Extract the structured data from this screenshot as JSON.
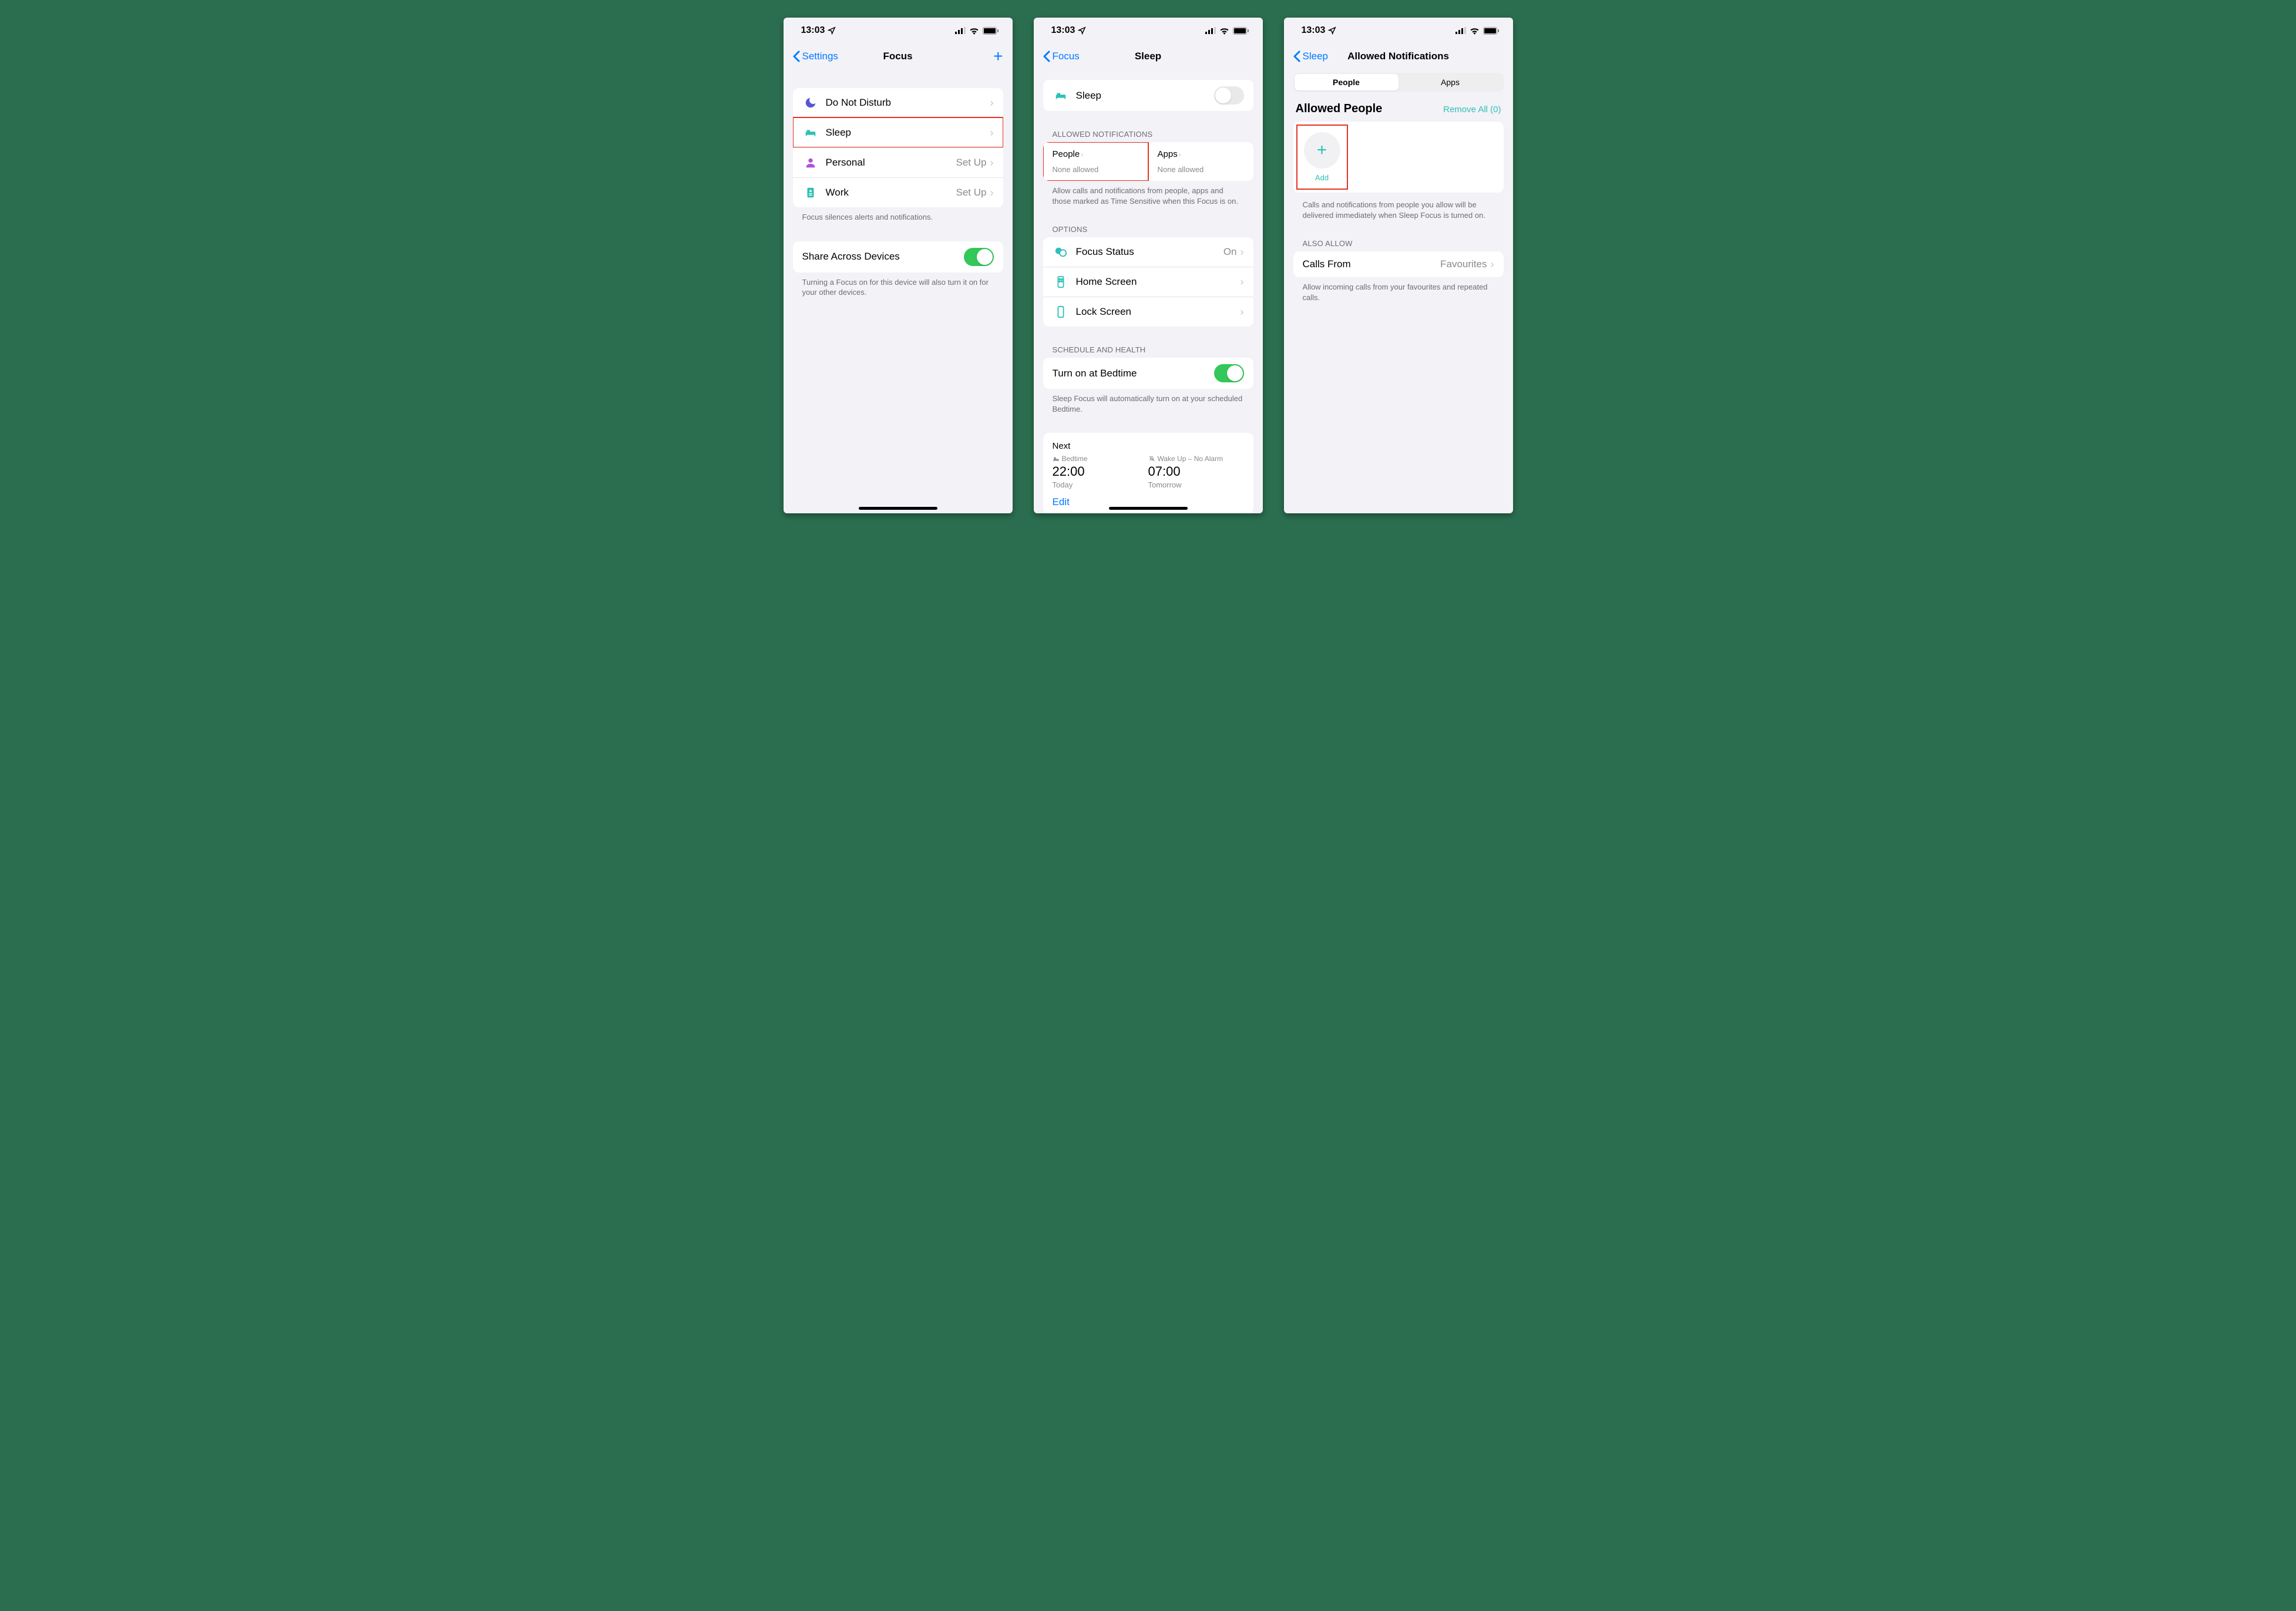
{
  "status": {
    "time": "13:03"
  },
  "screen1": {
    "back": "Settings",
    "title": "Focus",
    "items": [
      {
        "label": "Do Not Disturb",
        "value": ""
      },
      {
        "label": "Sleep",
        "value": ""
      },
      {
        "label": "Personal",
        "value": "Set Up"
      },
      {
        "label": "Work",
        "value": "Set Up"
      }
    ],
    "footer1": "Focus silences alerts and notifications.",
    "share_label": "Share Across Devices",
    "footer2": "Turning a Focus on for this device will also turn it on for your other devices."
  },
  "screen2": {
    "back": "Focus",
    "title": "Sleep",
    "toggle_label": "Sleep",
    "allowed_header": "ALLOWED NOTIFICATIONS",
    "people_label": "People",
    "people_value": "None allowed",
    "apps_label": "Apps",
    "apps_value": "None allowed",
    "allowed_footer": "Allow calls and notifications from people, apps and those marked as Time Sensitive when this Focus is on.",
    "options_header": "OPTIONS",
    "focus_status_label": "Focus Status",
    "focus_status_value": "On",
    "home_screen_label": "Home Screen",
    "lock_screen_label": "Lock Screen",
    "schedule_header": "SCHEDULE AND HEALTH",
    "bedtime_toggle_label": "Turn on at Bedtime",
    "schedule_footer": "Sleep Focus will automatically turn on at your scheduled Bedtime.",
    "next_label": "Next",
    "bedtime_meta": "Bedtime",
    "bedtime_time": "22:00",
    "bedtime_day": "Today",
    "wakeup_meta": "Wake Up – No Alarm",
    "wakeup_time": "07:00",
    "wakeup_day": "Tomorrow",
    "edit_label": "Edit"
  },
  "screen3": {
    "back": "Sleep",
    "title": "Allowed Notifications",
    "seg_people": "People",
    "seg_apps": "Apps",
    "allowed_people_title": "Allowed People",
    "remove_all": "Remove All (0)",
    "add_label": "Add",
    "people_footer": "Calls and notifications from people you allow will be delivered immediately when Sleep Focus is turned on.",
    "also_allow_header": "ALSO ALLOW",
    "calls_from_label": "Calls From",
    "calls_from_value": "Favourites",
    "calls_footer": "Allow incoming calls from your favourites and repeated calls."
  }
}
